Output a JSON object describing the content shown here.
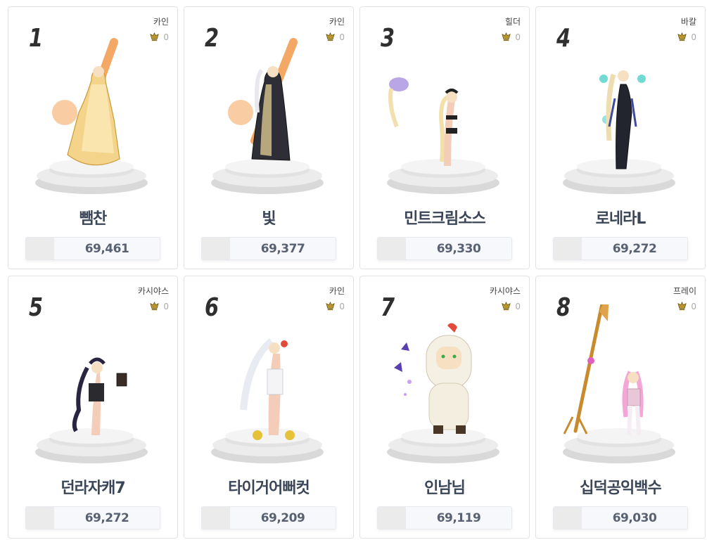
{
  "rankings": [
    {
      "rank": "1",
      "job": "카인",
      "fame": "0",
      "name": "뺌찬",
      "score": "69,461",
      "character": "golden-robed-character-with-flaming-staff"
    },
    {
      "rank": "2",
      "job": "카인",
      "fame": "0",
      "name": "빛",
      "score": "69,377",
      "character": "dark-robed-character-with-flaming-staff"
    },
    {
      "rank": "3",
      "job": "힐더",
      "fame": "0",
      "name": "민트크림소스",
      "score": "69,330",
      "character": "swimsuit-character-with-bird-pet"
    },
    {
      "rank": "4",
      "job": "바칼",
      "fame": "0",
      "name": "로네라L",
      "score": "69,272",
      "character": "black-armored-character-with-blue-flames"
    },
    {
      "rank": "5",
      "job": "카시야스",
      "fame": "0",
      "name": "던라자캐7",
      "score": "69,272",
      "character": "dark-haired-character-with-book"
    },
    {
      "rank": "6",
      "job": "카인",
      "fame": "0",
      "name": "타이거어뻐컷",
      "score": "69,209",
      "character": "white-haired-character-with-chick-pets"
    },
    {
      "rank": "7",
      "job": "카시야스",
      "fame": "0",
      "name": "인남님",
      "score": "69,119",
      "character": "chicken-costume-character-with-butterflies"
    },
    {
      "rank": "8",
      "job": "프레이",
      "fame": "0",
      "name": "십덕공익백수",
      "score": "69,030",
      "character": "pink-haired-character-with-golden-spear"
    }
  ],
  "colors": {
    "rank_text": "#2f2f2f",
    "name_text": "#3a4657",
    "score_text": "#596273",
    "fame_icon": "#b8962e"
  }
}
